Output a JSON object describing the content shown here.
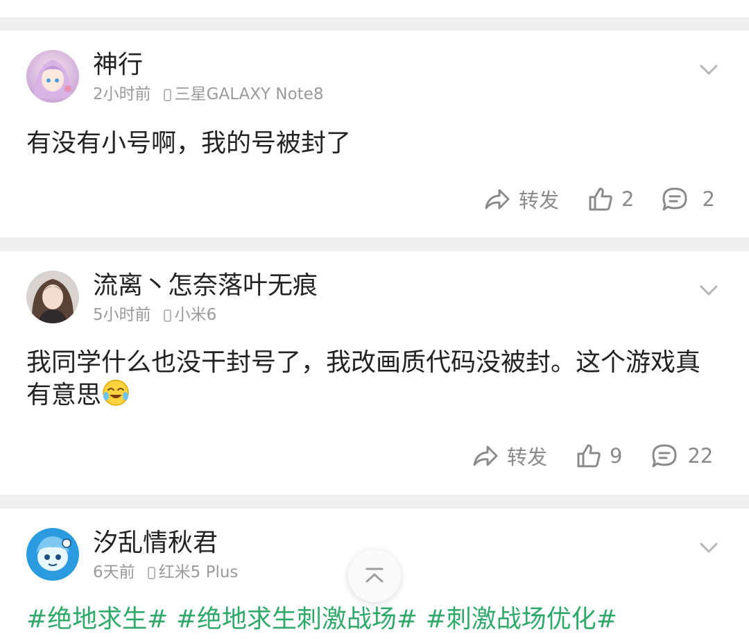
{
  "comments": [
    {
      "username": "神行",
      "time": "2小时前",
      "device": "三星GALAXY Note8",
      "content": "有没有小号啊，我的号被封了",
      "forward_label": "转发",
      "likes": "2",
      "replies": "2"
    },
    {
      "username": "流离丶怎奈落叶无痕",
      "time": "5小时前",
      "device": "小米6",
      "content": "我同学什么也没干封号了，我改画质代码没被封。这个游戏真有意思",
      "forward_label": "转发",
      "likes": "9",
      "replies": "22"
    },
    {
      "username": "汐乱情秋君",
      "time": "6天前",
      "device": "红米5 Plus",
      "tags": "#绝地求生# #绝地求生刺激战场# #刺激战场优化#"
    }
  ],
  "colors": {
    "accent_tag": "#2ea96a",
    "background": "#efefef"
  },
  "icons": [
    "phone-icon",
    "chevron-down-icon",
    "share-icon",
    "thumbs-up-icon",
    "comment-icon",
    "laughing-emoji-icon",
    "scroll-to-top-icon"
  ]
}
